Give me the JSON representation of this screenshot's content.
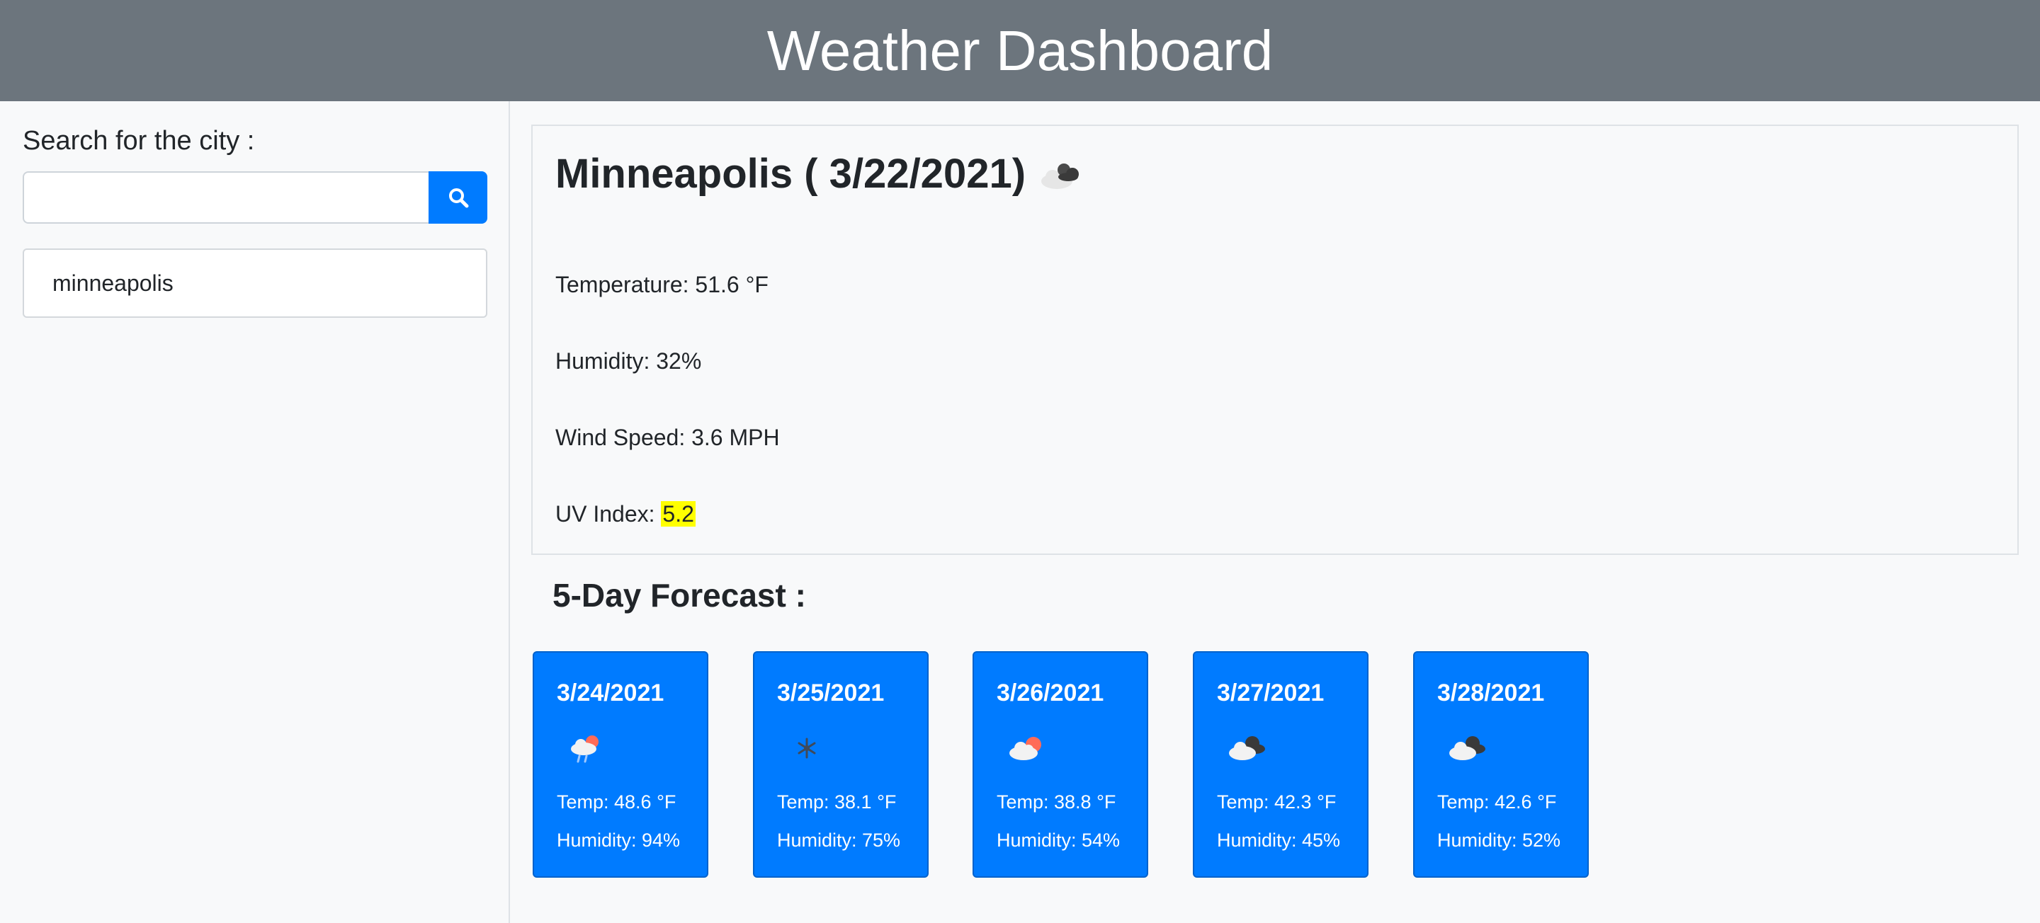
{
  "header": {
    "title": "Weather Dashboard"
  },
  "sidebar": {
    "search_label": "Search for the city :",
    "search_value": "",
    "search_placeholder": "",
    "search_button_icon": "search-icon",
    "history": [
      "minneapolis"
    ]
  },
  "current": {
    "title": "Minneapolis ( 3/22/2021)",
    "icon": "broken-clouds-icon",
    "temperature": "Temperature: 51.6 °F",
    "humidity": "Humidity: 32%",
    "wind": "Wind Speed: 3.6 MPH",
    "uv_label": "UV Index: ",
    "uv_value": "5.2",
    "uv_color": "#ffff00"
  },
  "forecast": {
    "title": "5-Day Forecast :",
    "days": [
      {
        "date": "3/24/2021",
        "icon": "rain-cloud-sun-icon",
        "temp": "Temp: 48.6 °F",
        "humidity": "Humidity: 94%"
      },
      {
        "date": "3/25/2021",
        "icon": "snowflake-icon",
        "temp": "Temp: 38.1 °F",
        "humidity": "Humidity: 75%"
      },
      {
        "date": "3/26/2021",
        "icon": "cloud-sun-icon",
        "temp": "Temp: 38.8 °F",
        "humidity": "Humidity: 54%"
      },
      {
        "date": "3/27/2021",
        "icon": "broken-clouds-icon",
        "temp": "Temp: 42.3 °F",
        "humidity": "Humidity: 45%"
      },
      {
        "date": "3/28/2021",
        "icon": "broken-clouds-icon",
        "temp": "Temp: 42.6 °F",
        "humidity": "Humidity: 52%"
      }
    ]
  },
  "colors": {
    "header_bg": "#6c757d",
    "accent": "#007bff",
    "page_bg": "#f8f9fa"
  }
}
